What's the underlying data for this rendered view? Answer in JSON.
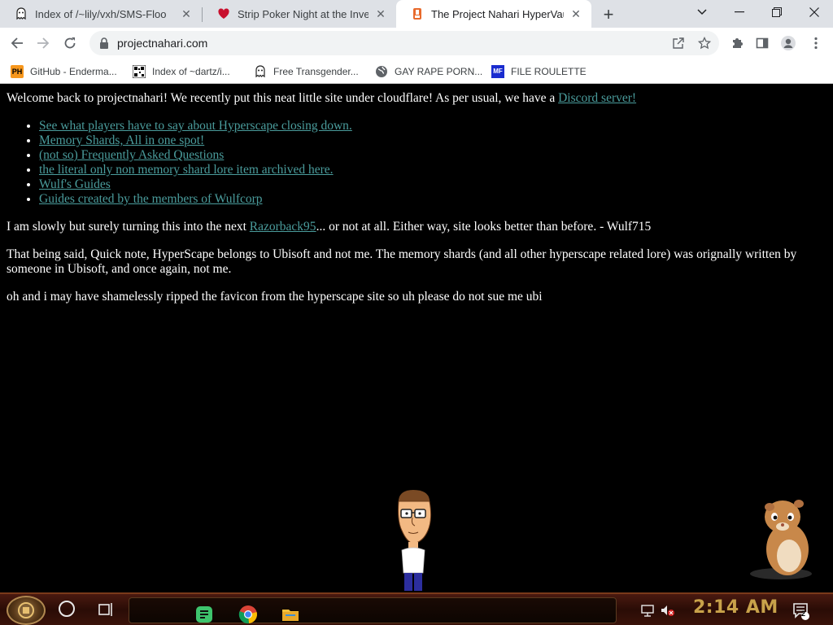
{
  "browser": {
    "tabs": [
      {
        "title": "Index of /~lily/vxh/SMS-Floo",
        "icon": "ghost-icon",
        "active": false
      },
      {
        "title": "Strip Poker Night at the Inven",
        "icon": "heart-icon",
        "active": false
      },
      {
        "title": "The Project Nahari HyperVault",
        "icon": "hyperscape-icon",
        "active": true
      }
    ],
    "address": "projectnahari.com",
    "bookmarks": [
      {
        "label": "GitHub - Enderma...",
        "icon": "pornhub-icon",
        "icon_text": "PH"
      },
      {
        "label": "Index of ~dartz/i...",
        "icon": "qr-icon",
        "icon_text": ""
      },
      {
        "label": "Free Transgender...",
        "icon": "ghost-icon",
        "icon_text": ""
      },
      {
        "label": "GAY RAPE PORN...",
        "icon": "globe-icon",
        "icon_text": ""
      },
      {
        "label": "FILE ROULETTE",
        "icon": "file-roulette-icon",
        "icon_text": "MF"
      }
    ]
  },
  "page": {
    "intro_text": "Welcome back to projectnahari! We recently put this neat little site under cloudflare! As per usual, we have a ",
    "intro_link": "Discord server!",
    "links": [
      "See what players have to say about Hyperscape closing down.",
      "Memory Shards, All in one spot!",
      "(not so) Frequently Asked Questions",
      "the literal only non memory shard lore item archived here.",
      "Wulf's Guides",
      "Guides created by the members of Wulfcorp"
    ],
    "para2_before": "I am slowly but surely turning this into the next ",
    "para2_link": "Razorback95",
    "para2_after": "... or not at all. Either way, site looks better than before. - Wulf715",
    "para3": "That being said, Quick note, HyperScape belongs to Ubisoft and not me. The memory shards (and all other hyperscape related lore) was orignally written by someone in Ubisoft, and once again, not me.",
    "para4": "oh and i may have shamelessly ripped the favicon from the hyperscape site so uh please do not sue me ubi"
  },
  "taskbar": {
    "clock": "2:14 AM",
    "notification_count": "2"
  },
  "colors": {
    "link": "#4a9c9c",
    "page_bg": "#000000",
    "clock": "#c8a24a"
  }
}
